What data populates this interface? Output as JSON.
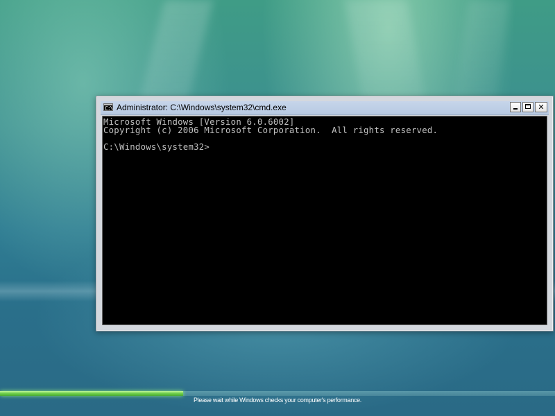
{
  "window": {
    "title": "Administrator: C:\\Windows\\system32\\cmd.exe",
    "icon": "cmd-icon",
    "controls": {
      "minimize": "minimize-icon",
      "maximize": "maximize-icon",
      "close_label": "✕"
    }
  },
  "console": {
    "lines": [
      "Microsoft Windows [Version 6.0.6002]",
      "Copyright (c) 2006 Microsoft Corporation.  All rights reserved.",
      "",
      "C:\\Windows\\system32>"
    ],
    "text_color": "#c0c0c0",
    "background": "#000000"
  },
  "status": {
    "message": "Please wait while Windows checks your computer's performance.",
    "progress": 0.33,
    "progress_color": "#6fcf4a"
  },
  "desktop": {
    "wallpaper": "Windows Vista aurora"
  }
}
